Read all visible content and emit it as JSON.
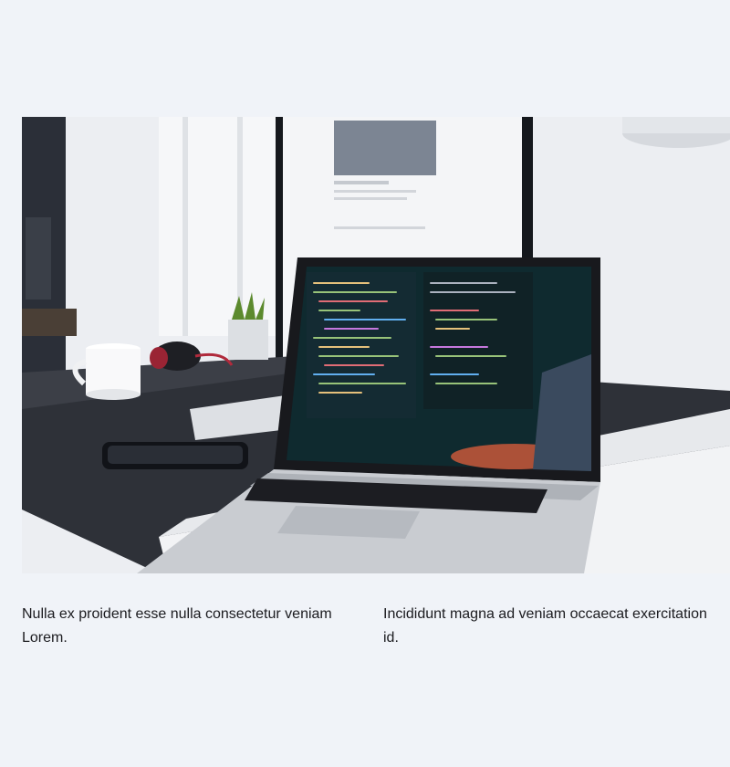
{
  "hero_image": {
    "alt": "Laptop showing code on a desk with a monitor, coffee mug, headphones, phone and plant",
    "icon": "photo-icon"
  },
  "captions": [
    {
      "text": "Nulla ex proident esse nulla consectetur veniam Lorem."
    },
    {
      "text": "Incididunt magna ad veniam occaecat exercitation id."
    }
  ]
}
